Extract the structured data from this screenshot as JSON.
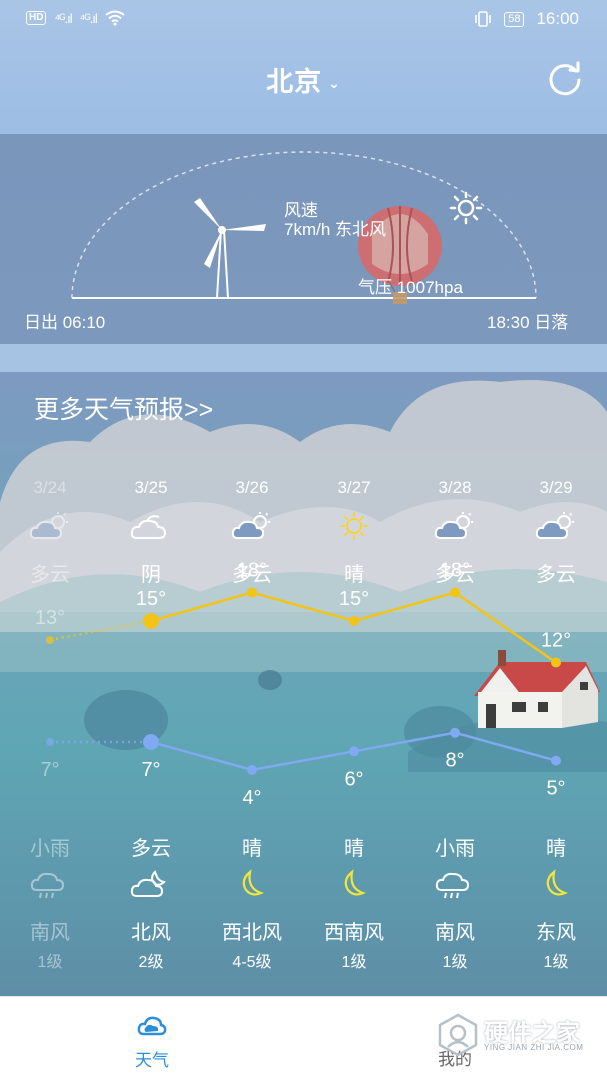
{
  "status_bar": {
    "hd": "HD",
    "signal1": "⁴ᴳ.ıl",
    "signal2": "⁴ᴳ.ıl",
    "battery": "58",
    "time": "16:00"
  },
  "header": {
    "city": "北京",
    "chevron": "⌄"
  },
  "sun_panel": {
    "wind_label": "风速",
    "wind_value": "7km/h 东北风",
    "pressure": "气压 1007hpa",
    "sunrise": "日出 06:10",
    "sunset": "18:30 日落"
  },
  "forecast": {
    "more_link": "更多天气预报>>",
    "days": [
      {
        "date": "3/24",
        "day_weather": "多云",
        "day_icon": "partly-cloudy-icon",
        "high": "13°",
        "low": "7°",
        "night_weather": "小雨",
        "night_icon": "rain-icon",
        "wind_dir": "南风",
        "wind_level": "1级"
      },
      {
        "date": "3/25",
        "day_weather": "阴",
        "day_icon": "overcast-icon",
        "high": "15°",
        "low": "7°",
        "night_weather": "多云",
        "night_icon": "cloudy-night-icon",
        "wind_dir": "北风",
        "wind_level": "2级"
      },
      {
        "date": "3/26",
        "day_weather": "多云",
        "day_icon": "partly-cloudy-icon",
        "high": "18°",
        "low": "4°",
        "night_weather": "晴",
        "night_icon": "moon-icon",
        "wind_dir": "西北风",
        "wind_level": "4-5级"
      },
      {
        "date": "3/27",
        "day_weather": "晴",
        "day_icon": "sun-icon",
        "high": "15°",
        "low": "6°",
        "night_weather": "晴",
        "night_icon": "moon-icon",
        "wind_dir": "西南风",
        "wind_level": "1级"
      },
      {
        "date": "3/28",
        "day_weather": "多云",
        "day_icon": "partly-cloudy-icon",
        "high": "18°",
        "low": "8°",
        "night_weather": "小雨",
        "night_icon": "rain-icon",
        "wind_dir": "南风",
        "wind_level": "1级"
      },
      {
        "date": "3/29",
        "day_weather": "多云",
        "day_icon": "partly-cloudy-icon",
        "high": "12°",
        "low": "5°",
        "night_weather": "晴",
        "night_icon": "moon-icon",
        "wind_dir": "东风",
        "wind_level": "1级"
      }
    ]
  },
  "chart_data": {
    "type": "line",
    "categories": [
      "3/24",
      "3/25",
      "3/26",
      "3/27",
      "3/28",
      "3/29"
    ],
    "series": [
      {
        "values": [
          13,
          15,
          18,
          15,
          18,
          12
        ]
      },
      {
        "values": [
          7,
          7,
          4,
          6,
          8,
          5
        ]
      }
    ],
    "colors": {
      "high": "#f2c418",
      "low": "#7fa9f0"
    }
  },
  "bottom_nav": {
    "weather_label": "天气",
    "mine_label": "我的",
    "active_color": "#2a8fd8"
  },
  "watermark": {
    "title": "硬件之家",
    "subtitle": "YING JIAN ZHI JIA.COM"
  }
}
